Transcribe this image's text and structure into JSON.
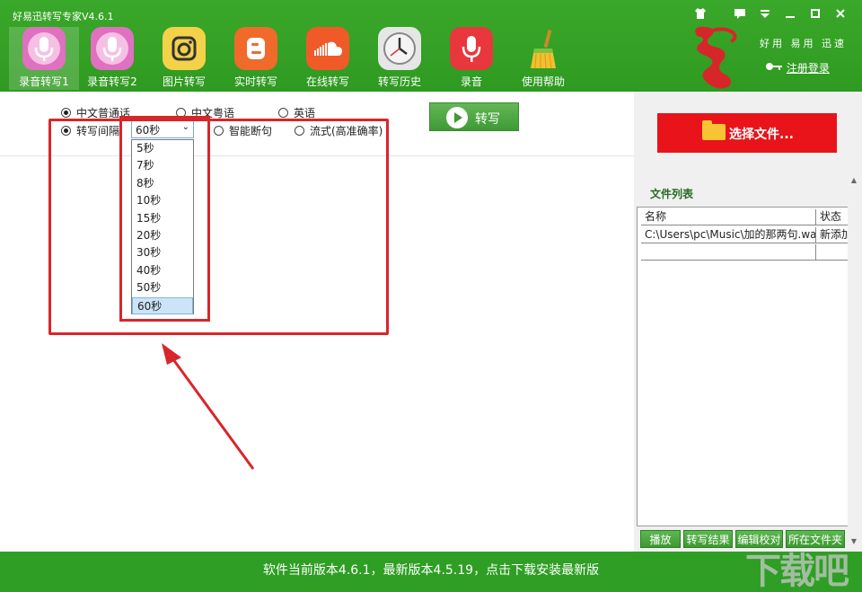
{
  "window": {
    "title": "好易迅转写专家V4.6.1",
    "controls": [
      "shirt-icon",
      "message-icon",
      "menu-icon",
      "minimize-icon",
      "maximize-icon",
      "close-icon"
    ]
  },
  "toolbar": {
    "items": [
      {
        "label": "录音转写1",
        "icon": "microphone-icon",
        "color": "#e070c0",
        "active": true
      },
      {
        "label": "录音转写2",
        "icon": "microphone-icon",
        "color": "#e070c0",
        "active": false
      },
      {
        "label": "图片转写",
        "icon": "camera-icon",
        "color": "#f3d24a",
        "active": false
      },
      {
        "label": "实时转写",
        "icon": "blogger-icon",
        "color": "#ef6a2b",
        "active": false
      },
      {
        "label": "在线转写",
        "icon": "cloud-icon",
        "color": "#f05a28",
        "active": false
      },
      {
        "label": "转写历史",
        "icon": "clock-icon",
        "color": "#e6e6e6",
        "active": false
      },
      {
        "label": "录音",
        "icon": "mic-red-icon",
        "color": "#e8383d",
        "active": false
      },
      {
        "label": "使用帮助",
        "icon": "broom-icon",
        "color": "#f0c030",
        "active": false
      }
    ]
  },
  "brand": {
    "slogan": "好用 易用 迅速",
    "register_label": "注册登录"
  },
  "options": {
    "languages": [
      {
        "label": "中文普通话",
        "checked": true
      },
      {
        "label": "中文粤语",
        "checked": false
      },
      {
        "label": "英语",
        "checked": false
      }
    ],
    "modes": [
      {
        "label": "转写间隔",
        "checked": true
      },
      {
        "label": "智能断句",
        "checked": false
      },
      {
        "label": "流式(高准确率)",
        "checked": false
      }
    ],
    "interval_value": "60秒",
    "interval_options": [
      "5秒",
      "7秒",
      "8秒",
      "10秒",
      "15秒",
      "20秒",
      "30秒",
      "40秒",
      "50秒",
      "60秒"
    ],
    "interval_selected_index": 9,
    "transcribe_label": "转写"
  },
  "right": {
    "choose_file_label": "选择文件...",
    "file_list_title": "文件列表",
    "columns": [
      "名称",
      "状态"
    ],
    "rows": [
      {
        "name": "C:\\Users\\pc\\Music\\加的那两句.wa",
        "status": "新添加"
      },
      {
        "name": "",
        "status": ""
      }
    ],
    "actions": [
      "播放",
      "转写结果",
      "编辑校对",
      "所在文件夹"
    ]
  },
  "footer": {
    "text": "软件当前版本4.6.1，最新版本4.5.19，点击下载安装最新版"
  },
  "watermark": "下载吧"
}
